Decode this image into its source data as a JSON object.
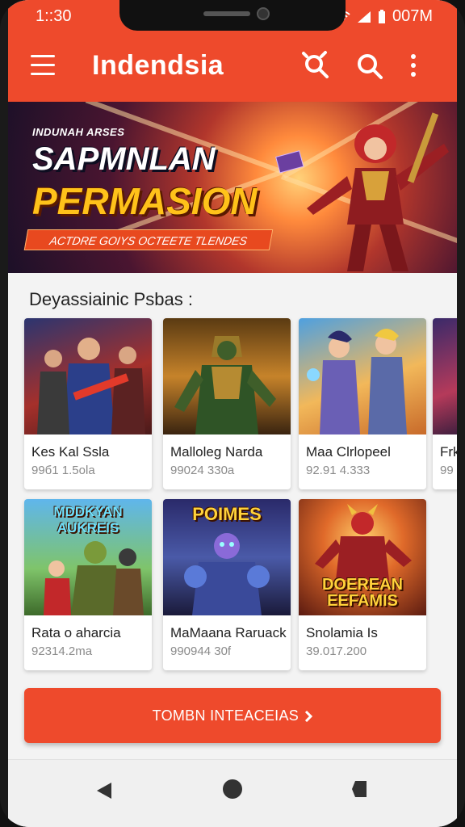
{
  "status": {
    "time": "1::30",
    "right": "007M"
  },
  "app": {
    "title": "Indendsia"
  },
  "banner": {
    "eyebrow": "INDUNAH ARSES",
    "line1": "SAPMNLAN",
    "line2": "PERMASION",
    "tagline": "ACTDRE GOIYS OCTEETE TLENDES"
  },
  "section": {
    "title": "Deyassiainic Psbas  :"
  },
  "cards": [
    {
      "name": "Kes Kal Ssla",
      "meta": "99б1 1.5ola",
      "thumb_text": ""
    },
    {
      "name": "Malloleg Narda",
      "meta": "99024 330a",
      "thumb_text": ""
    },
    {
      "name": "Maa Clrlopeel",
      "meta": "92.91 4.333",
      "thumb_text": ""
    },
    {
      "name": "Frk",
      "meta": "99",
      "thumb_text": ""
    },
    {
      "name": "Rata o aharcia",
      "meta": "92314.2ma",
      "thumb_text": "MDDKYAN AUKREIS"
    },
    {
      "name": "MaMaana Raruack",
      "meta": "990944 30f",
      "thumb_text": "POIMES"
    },
    {
      "name": "Snolamia Is",
      "meta": "39.017.200",
      "thumb_text": "DOEREAN EEFAMIS"
    }
  ],
  "cta": {
    "label": "TOMBN INTEACEIAS"
  },
  "colors": {
    "accent": "#ee4a2c",
    "banner_gold": "#ffc21a"
  },
  "icons": [
    "menu-icon",
    "search-people-icon",
    "search-icon",
    "more-vert-icon",
    "back-icon",
    "home-icon",
    "recent-icon"
  ]
}
